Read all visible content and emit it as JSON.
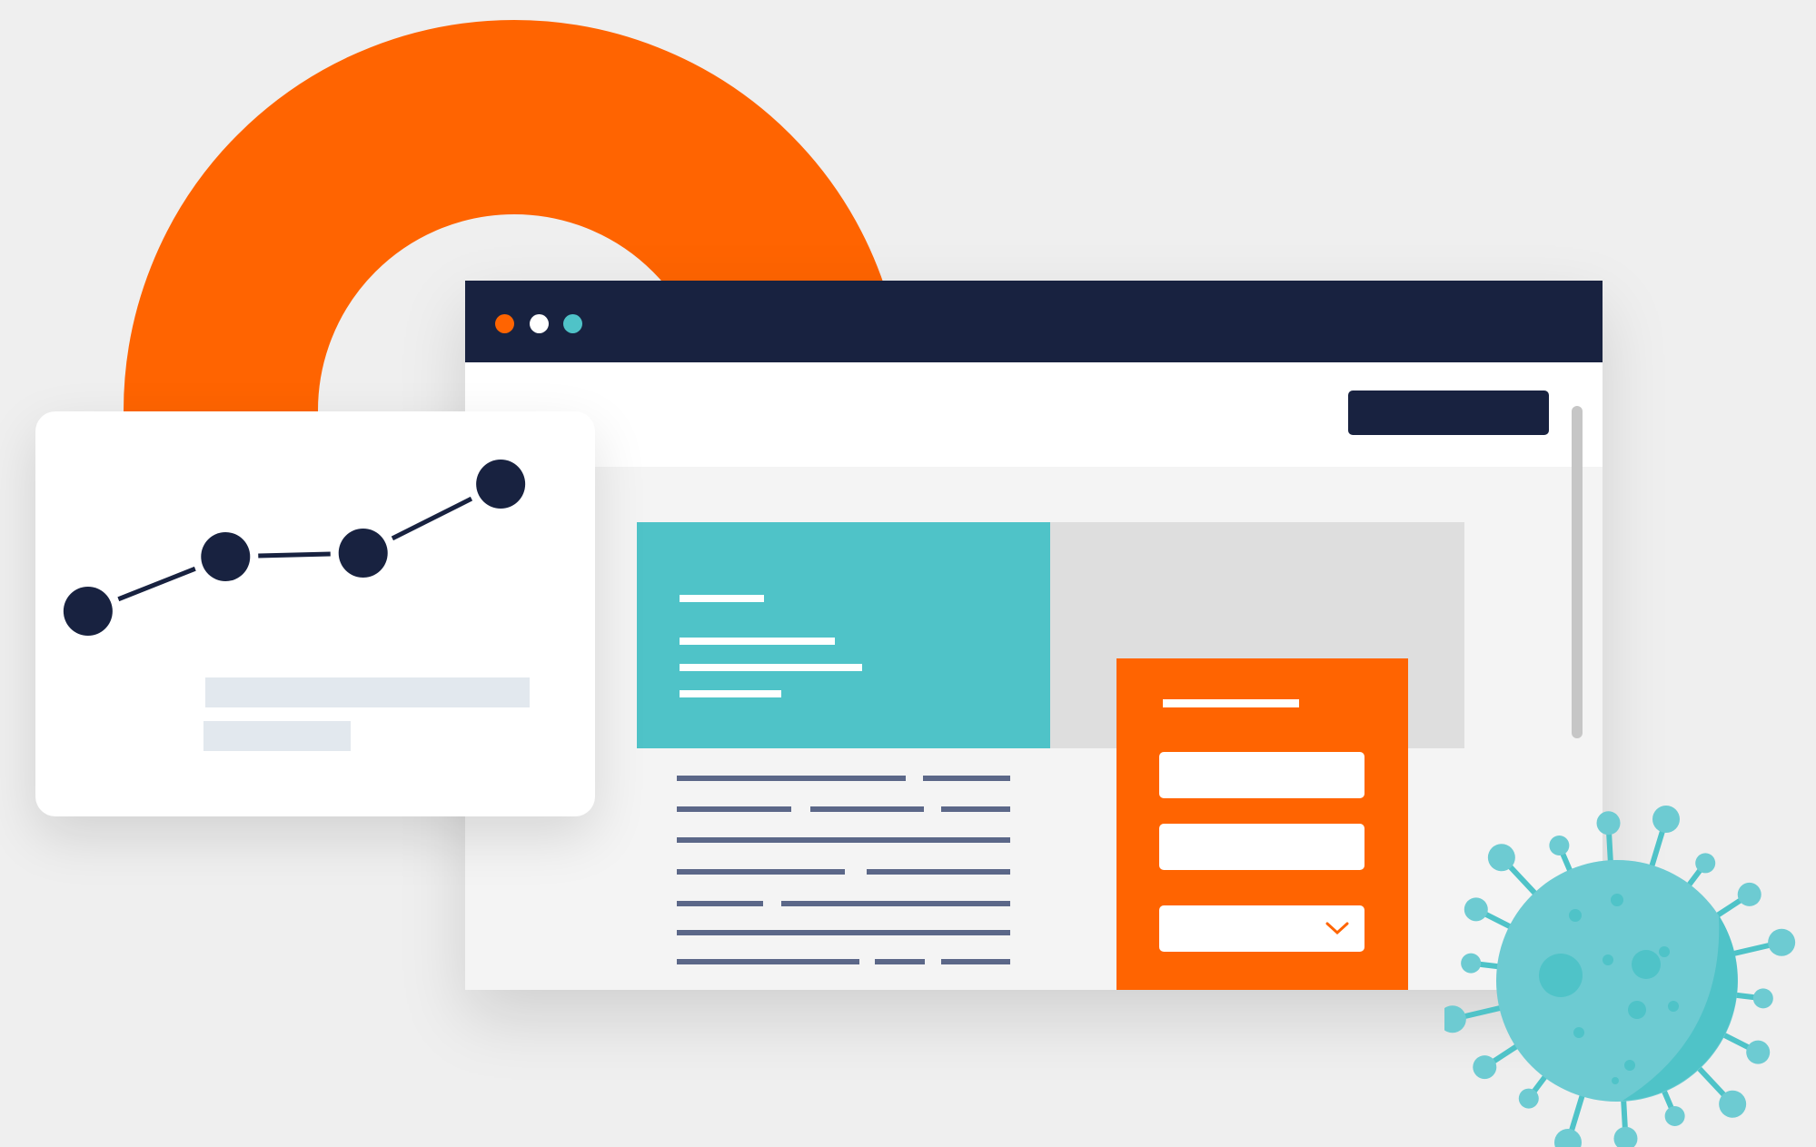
{
  "colors": {
    "background": "#efefef",
    "accent_orange": "#ff6401",
    "navy": "#182240",
    "teal": "#4fc3c8",
    "text_placeholder": "#5b6788",
    "placeholder_grey": "#e2e8ee",
    "virus_light": "#6dcbd2",
    "virus_dark": "#4fc3c8"
  },
  "decor": {
    "ring_icon": "orange-ring-icon",
    "virus_icon": "virus-icon"
  },
  "browser": {
    "window_controls": [
      {
        "name": "close-dot",
        "color": "#ff6401"
      },
      {
        "name": "minimize-dot",
        "color": "#ffffff"
      },
      {
        "name": "maximize-dot",
        "color": "#4fc3c8"
      }
    ],
    "nav_button_label": "",
    "form": {
      "title": "",
      "fields": [
        {
          "name": "form-field-1",
          "value": ""
        },
        {
          "name": "form-field-2",
          "value": ""
        }
      ],
      "select": {
        "value": "",
        "icon": "chevron-down-icon"
      }
    }
  },
  "chart_card": {
    "chart_data": {
      "type": "line",
      "x": [
        1,
        2,
        3,
        4
      ],
      "series": [
        {
          "values": [
            1.0,
            2.5,
            2.6,
            4.5
          ]
        }
      ],
      "xlim": [
        0.75,
        4.25
      ],
      "ylim": [
        0.0,
        5.0
      ]
    }
  }
}
